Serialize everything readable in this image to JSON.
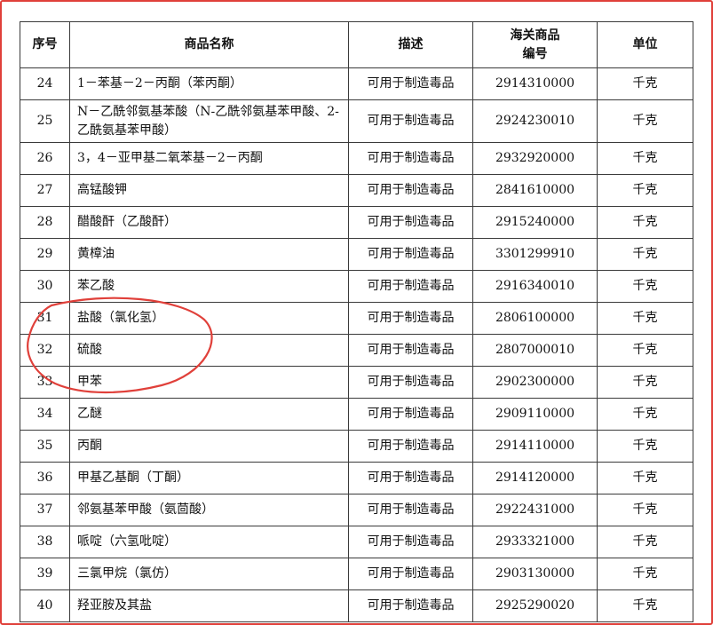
{
  "table": {
    "headers": {
      "no": "序号",
      "name": "商品名称",
      "desc": "描述",
      "code_line1": "海关商品",
      "code_line2": "编号",
      "unit": "单位"
    },
    "rows": [
      {
        "no": "24",
        "name": "1－苯基－2－丙酮（苯丙酮）",
        "desc": "可用于制造毒品",
        "code": "2914310000",
        "unit": "千克"
      },
      {
        "no": "25",
        "name": "N－乙酰邻氨基苯酸（N-乙酰邻氨基苯甲酸、2-乙酰氨基苯甲酸）",
        "desc": "可用于制造毒品",
        "code": "2924230010",
        "unit": "千克"
      },
      {
        "no": "26",
        "name": "3，4－亚甲基二氧苯基－2－丙酮",
        "desc": "可用于制造毒品",
        "code": "2932920000",
        "unit": "千克"
      },
      {
        "no": "27",
        "name": "高锰酸钾",
        "desc": "可用于制造毒品",
        "code": "2841610000",
        "unit": "千克"
      },
      {
        "no": "28",
        "name": "醋酸酐（乙酸酐）",
        "desc": "可用于制造毒品",
        "code": "2915240000",
        "unit": "千克"
      },
      {
        "no": "29",
        "name": "黄樟油",
        "desc": "可用于制造毒品",
        "code": "3301299910",
        "unit": "千克"
      },
      {
        "no": "30",
        "name": "苯乙酸",
        "desc": "可用于制造毒品",
        "code": "2916340010",
        "unit": "千克"
      },
      {
        "no": "31",
        "name": "盐酸（氯化氢）",
        "desc": "可用于制造毒品",
        "code": "2806100000",
        "unit": "千克"
      },
      {
        "no": "32",
        "name": "硫酸",
        "desc": "可用于制造毒品",
        "code": "2807000010",
        "unit": "千克"
      },
      {
        "no": "33",
        "name": "甲苯",
        "desc": "可用于制造毒品",
        "code": "2902300000",
        "unit": "千克"
      },
      {
        "no": "34",
        "name": "乙醚",
        "desc": "可用于制造毒品",
        "code": "2909110000",
        "unit": "千克"
      },
      {
        "no": "35",
        "name": "丙酮",
        "desc": "可用于制造毒品",
        "code": "2914110000",
        "unit": "千克"
      },
      {
        "no": "36",
        "name": "甲基乙基酮（丁酮）",
        "desc": "可用于制造毒品",
        "code": "2914120000",
        "unit": "千克"
      },
      {
        "no": "37",
        "name": "邻氨基苯甲酸（氨茴酸）",
        "desc": "可用于制造毒品",
        "code": "2922431000",
        "unit": "千克"
      },
      {
        "no": "38",
        "name": "哌啶（六氢吡啶）",
        "desc": "可用于制造毒品",
        "code": "2933321000",
        "unit": "千克"
      },
      {
        "no": "39",
        "name": "三氯甲烷（氯仿）",
        "desc": "可用于制造毒品",
        "code": "2903130000",
        "unit": "千克"
      },
      {
        "no": "40",
        "name": "羟亚胺及其盐",
        "desc": "可用于制造毒品",
        "code": "2925290020",
        "unit": "千克"
      }
    ]
  },
  "colors": {
    "annotation": "#e0403a",
    "frame": "#e0403a",
    "grid": "#3a3a3a"
  }
}
